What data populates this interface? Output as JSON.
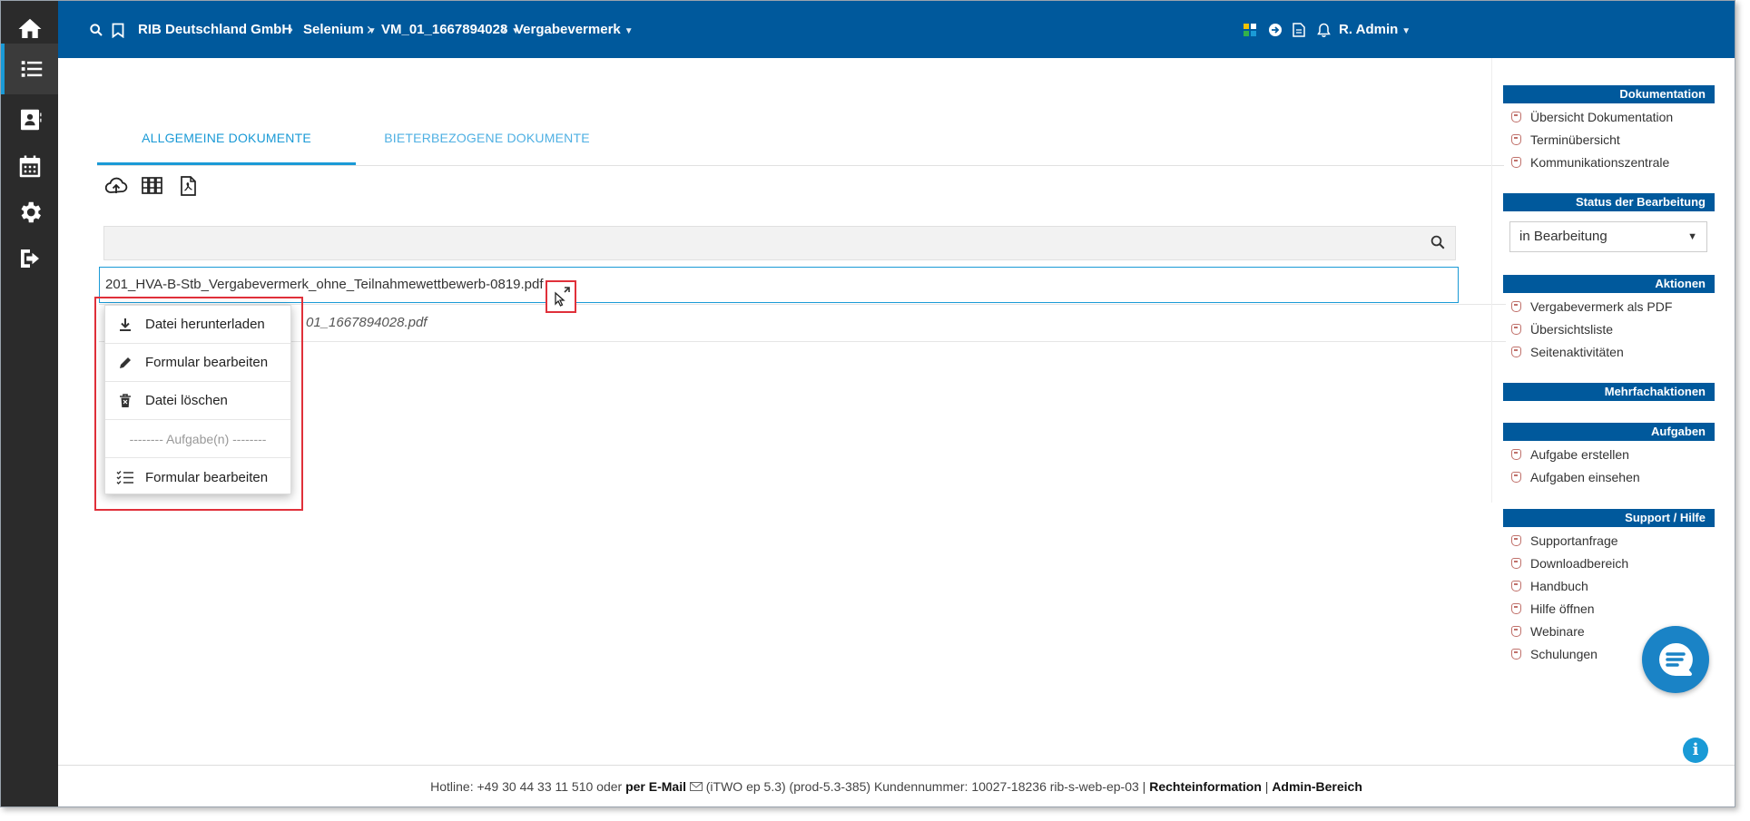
{
  "topbar": {
    "org": "RIB Deutschland GmbH",
    "project": "Selenium",
    "record": "VM_01_1667894028",
    "section": "Vergabevermerk",
    "user": "R. Admin"
  },
  "tabs": {
    "general": "ALLGEMEINE DOKUMENTE",
    "bidder": "BIETERBEZOGENE DOKUMENTE"
  },
  "search": {
    "placeholder": ""
  },
  "documents": [
    {
      "name": "201_HVA-B-Stb_Vergabevermerk_ohne_Teilnahmewettbewerb-0819.pdf"
    },
    {
      "name": "01_1667894028.pdf"
    }
  ],
  "context_menu": {
    "download": "Datei herunterladen",
    "edit_form": "Formular bearbeiten",
    "delete": "Datei löschen",
    "tasks_divider": "-------- Aufgabe(n) --------",
    "task_edit_form": "Formular bearbeiten"
  },
  "right_panel": {
    "documentation": {
      "title": "Dokumentation",
      "items": [
        "Übersicht Dokumentation",
        "Terminübersicht",
        "Kommunikationszentrale"
      ]
    },
    "status": {
      "title": "Status der Bearbeitung",
      "value": "in Bearbeitung"
    },
    "actions": {
      "title": "Aktionen",
      "items": [
        "Vergabevermerk als PDF",
        "Übersichtsliste",
        "Seitenaktivitäten"
      ]
    },
    "bulk_actions": {
      "title": "Mehrfachaktionen"
    },
    "tasks": {
      "title": "Aufgaben",
      "items": [
        "Aufgabe erstellen",
        "Aufgaben einsehen"
      ]
    },
    "support": {
      "title": "Support / Hilfe",
      "items": [
        "Supportanfrage",
        "Downloadbereich",
        "Handbuch",
        "Hilfe öffnen",
        "Webinare",
        "Schulungen"
      ]
    }
  },
  "footer": {
    "hotline": "Hotline: +49 30 44 33 11 510 oder",
    "email": "per E-Mail",
    "version": "(iTWO ep 5.3) (prod-5.3-385)   Kundennummer: 10027-18236 rib-s-web-ep-03 |",
    "legal": "Rechteinformation",
    "pipe": "|",
    "admin": "Admin-Bereich"
  },
  "colors": {
    "topbar": "#00599c",
    "sidebar": "#2b2b2b",
    "accent": "#1a9ad6",
    "highlight": "#e0303a"
  }
}
